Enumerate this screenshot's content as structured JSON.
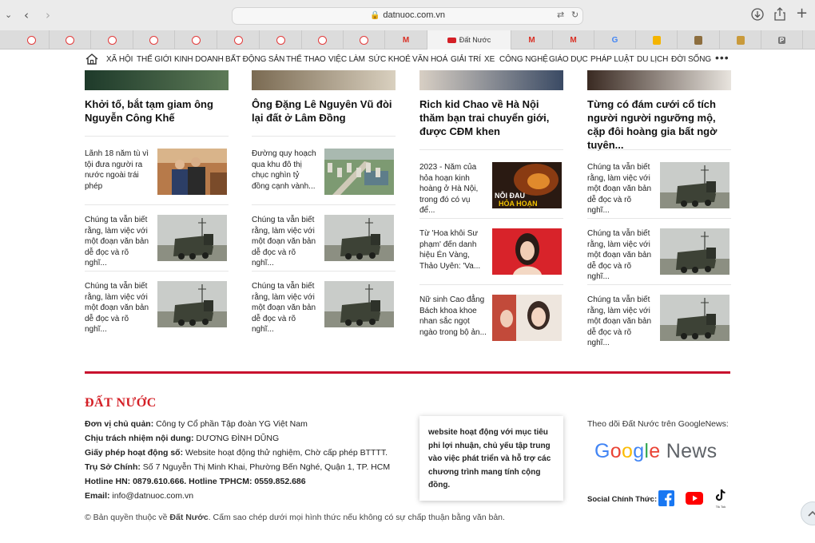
{
  "browser": {
    "url": "datnuoc.com.vn",
    "tabs": [
      {
        "icon": "red-circle-icon"
      },
      {
        "icon": "red-circle-icon"
      },
      {
        "icon": "red-circle-icon"
      },
      {
        "icon": "red-circle-icon"
      },
      {
        "icon": "red-circle-icon"
      },
      {
        "icon": "red-circle-icon"
      },
      {
        "icon": "red-circle-icon"
      },
      {
        "icon": "red-circle-icon"
      },
      {
        "icon": "red-circle-icon"
      },
      {
        "icon": "gmail-icon"
      },
      {
        "icon": "datnuoc-icon",
        "label": "Đất Nước",
        "active": true
      },
      {
        "icon": "gmail-icon"
      },
      {
        "icon": "gmail-icon"
      },
      {
        "icon": "google-icon"
      },
      {
        "icon": "colorful-icon"
      },
      {
        "icon": "image-icon"
      },
      {
        "icon": "box-icon"
      },
      {
        "icon": "p-icon"
      }
    ]
  },
  "nav": {
    "items": [
      "XÃ HỘI",
      "THẾ GIỚI",
      "KINH DOANH",
      "BẤT ĐỘNG SẢN",
      "THỂ THAO",
      "VIỆC LÀM",
      "SỨC KHOẺ",
      "VĂN HOÁ",
      "GIẢI TRÍ",
      "XE",
      "CÔNG NGHỆ",
      "GIÁO DỤC",
      "PHÁP LUẬT",
      "DU LỊCH",
      "ĐỜI SỐNG"
    ],
    "more": "•••"
  },
  "columns": [
    {
      "lead_title": "Khởi tố, bắt tạm giam ông Nguyễn Công Khế",
      "items": [
        {
          "text": "Lãnh 18 năm tù vì tội đưa người ra nước ngoài trái phép",
          "img": "court"
        },
        {
          "text": "Chúng ta vẫn biết rằng, làm việc với một đoạn văn bản dễ đọc và rõ nghĩ...",
          "img": "truck"
        },
        {
          "text": "Chúng ta vẫn biết rằng, làm việc với một đoạn văn bản dễ đọc và rõ nghĩ...",
          "img": "truck"
        }
      ]
    },
    {
      "lead_title": "Ông Đặng Lê Nguyên Vũ đòi lại đất ở Lâm Đồng",
      "items": [
        {
          "text": "Đường quy hoạch qua khu đô thị chục nghìn tỷ đồng cạnh vành...",
          "img": "aerial"
        },
        {
          "text": "Chúng ta vẫn biết rằng, làm việc với một đoạn văn bản dễ đọc và rõ nghĩ...",
          "img": "truck"
        },
        {
          "text": "Chúng ta vẫn biết rằng, làm việc với một đoạn văn bản dễ đọc và rõ nghĩ...",
          "img": "truck"
        }
      ]
    },
    {
      "lead_title": "Rich kid Chao về Hà Nội thăm bạn trai chuyển giới, được CĐM khen",
      "items": [
        {
          "text": "2023 - Năm của hỏa hoạn kinh hoàng ở Hà Nội, trong đó có vụ để...",
          "img": "fire",
          "img_caption_1": "NỖI ĐAU",
          "img_caption_2": "HỎA HOẠN"
        },
        {
          "text": "Từ 'Hoa khôi Sư phạm' đến danh hiệu Én Vàng, Thảo Uyên: 'Va...",
          "img": "portrait-red"
        },
        {
          "text": "Nữ sinh Cao đẳng Bách khoa khoe nhan sắc ngọt ngào trong bộ ản...",
          "img": "portrait-light"
        }
      ]
    },
    {
      "lead_title": "Từng có đám cưới cổ tích người người ngưỡng mộ, cặp đôi hoàng gia bất ngờ tuyên...",
      "items": [
        {
          "text": "Chúng ta vẫn biết rằng, làm việc với một đoạn văn bản dễ đọc và rõ nghĩ...",
          "img": "truck"
        },
        {
          "text": "Chúng ta vẫn biết rằng, làm việc với một đoạn văn bản dễ đọc và rõ nghĩ...",
          "img": "truck"
        },
        {
          "text": "Chúng ta vẫn biết rằng, làm việc với một đoạn văn bản dễ đọc và rõ nghĩ...",
          "img": "truck"
        }
      ]
    }
  ],
  "footer": {
    "logo": "ĐẤT NƯỚC",
    "lines": [
      {
        "label": "Đơn vị chủ quản:",
        "value": " Công ty Cổ phần Tập đoàn YG Việt Nam"
      },
      {
        "label": "Chịu trách nhiệm nội dung:",
        "value": " DƯƠNG ĐÌNH DŨNG"
      },
      {
        "label": "Giấy phép hoạt động số:",
        "value": " Website hoạt động thử nghiệm, Chờ cấp phép BTTTT."
      },
      {
        "label": "Trụ Sở Chính:",
        "value": " Số 7 Nguyễn Thị Minh Khai, Phường Bến Nghé, Quận 1, TP. HCM"
      },
      {
        "label": "Hotline HN: 0879.610.666. Hotline TPHCM: 0559.852.686",
        "value": ""
      },
      {
        "label": "Email:",
        "value": " info@datnuoc.com.vn"
      }
    ],
    "copyright_prefix": "© Bản quyền thuộc về ",
    "copyright_brand": "Đất Nước",
    "copyright_suffix": ".  Cấm sao chép dưới mọi hình thức nếu không có sự chấp thuận bằng văn bản.",
    "notice": "website hoạt động với mục tiêu phi lợi nhuận, chủ yếu tập trung vào việc phát triển và hỗ trợ các chương trình mang tính cộng đồng.",
    "google_news_label": "Theo dõi Đất Nước trên GoogleNews:",
    "google_news_logo_google": "Google",
    "google_news_logo_news": "News",
    "social_label": "Social Chính Thức:",
    "tiktok_label": "Tik Tok"
  },
  "colors": {
    "brand_red": "#d41f26",
    "divider_red": "#c8102e"
  }
}
